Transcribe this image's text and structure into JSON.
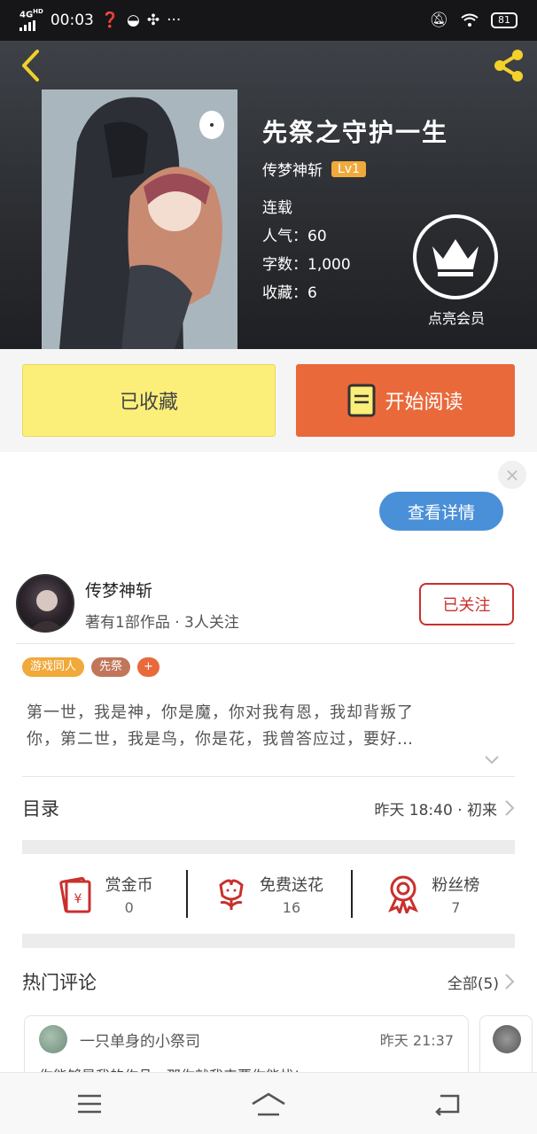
{
  "status_bar": {
    "network": "4G",
    "network_sup": "HD",
    "time": "00:03",
    "battery": "81"
  },
  "header": {
    "title": "先祭之守护一生",
    "author": "传梦神斩",
    "level": "Lv1",
    "status": "连载",
    "popularity": "人气：60",
    "word_count": "字数：1,000",
    "favorites": "收藏：6",
    "vip_label": "点亮会员"
  },
  "actions": {
    "collected_label": "已收藏",
    "read_label": "开始阅读"
  },
  "ad": {
    "details_label": "查看详情",
    "close_symbol": "×"
  },
  "author_section": {
    "name": "传梦神斩",
    "subtitle": "著有1部作品 · 3人关注",
    "follow_label": "已关注",
    "tags": [
      {
        "label": "游戏同人",
        "color": "#f0a93a"
      },
      {
        "label": "先祭",
        "color": "#c0765a"
      },
      {
        "label": "+",
        "color": "#e9693b"
      }
    ],
    "description_line1": "第一世，我是神，你是魔，你对我有恩，我却背叛了",
    "description_line2": "你，第二世，我是鸟，你是花，我曾答应过，要好…"
  },
  "catalog": {
    "title": "目录",
    "latest": "昨天 18:40 · 初来"
  },
  "stats": [
    {
      "label": "赏金币",
      "value": "0",
      "icon": "red-envelope-icon"
    },
    {
      "label": "免费送花",
      "value": "16",
      "icon": "flower-icon"
    },
    {
      "label": "粉丝榜",
      "value": "7",
      "icon": "medal-icon"
    }
  ],
  "hot_comments": {
    "title": "热门评论",
    "all_label": "全部(5)",
    "comment": {
      "user": "一只单身的小祭司",
      "time": "昨天 21:37",
      "text": "你能够是我的作品，那你就我来要你能找!"
    }
  },
  "colors": {
    "accent_orange": "#e9693b",
    "collected_yellow": "#fbef7a",
    "follow_red": "#c9302c",
    "ad_blue": "#4a90d9",
    "level_gold": "#f0a93a"
  }
}
